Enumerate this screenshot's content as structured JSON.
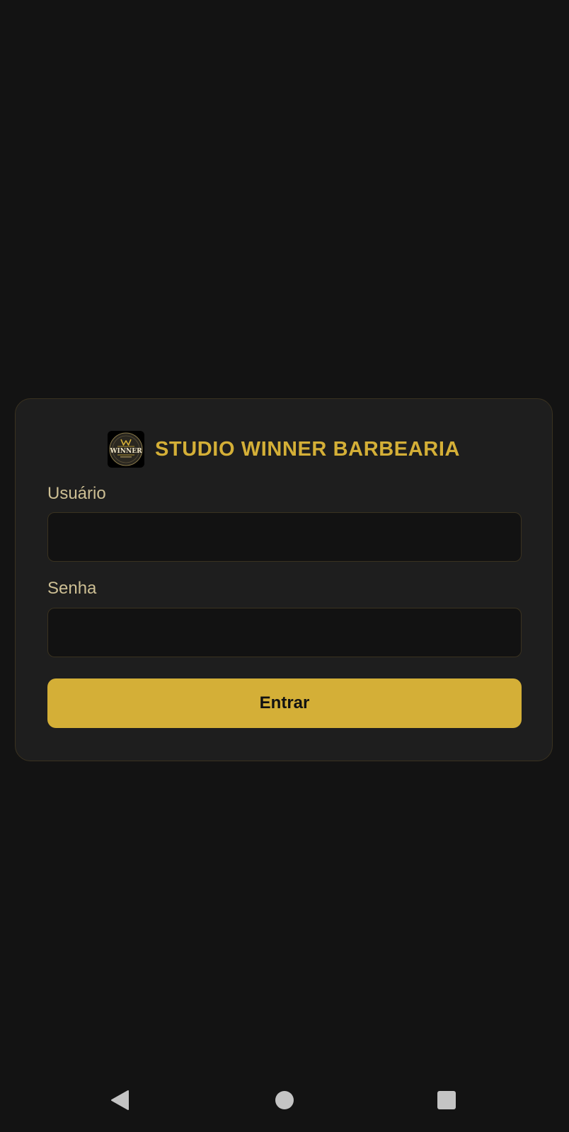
{
  "brand": {
    "title": "STUDIO WINNER BARBEARIA",
    "logo_text": "WINNER",
    "logo_icon": "barbershop-logo-icon"
  },
  "form": {
    "username_label": "Usuário",
    "username_value": "",
    "password_label": "Senha",
    "password_value": "",
    "submit_label": "Entrar"
  },
  "navigation_bar": {
    "back_icon": "back-triangle-icon",
    "home_icon": "home-circle-icon",
    "recents_icon": "recents-square-icon"
  },
  "colors": {
    "background": "#131313",
    "card": "#1e1e1e",
    "accent_gold": "#d4af37",
    "label": "#cdbf94",
    "input_background": "#121212",
    "nav_icons": "#c4c4c4"
  }
}
